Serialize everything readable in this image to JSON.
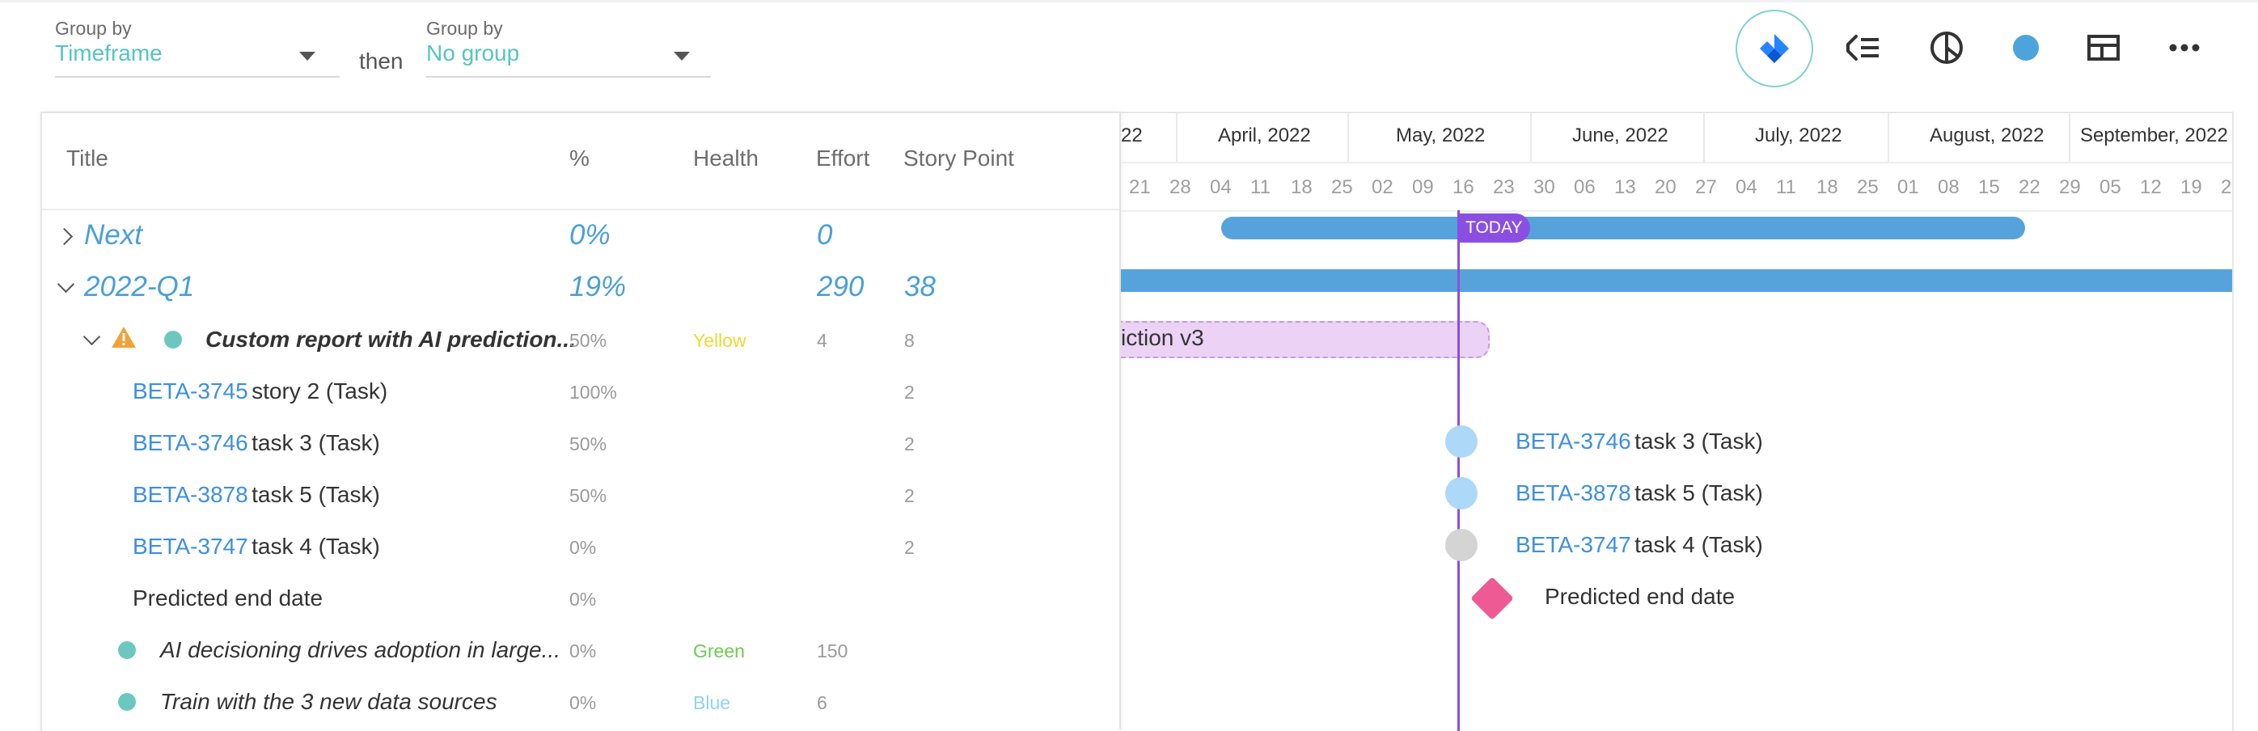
{
  "toolbar": {
    "group1_label": "Group by",
    "group1_value": "Timeframe",
    "then_label": "then",
    "group2_label": "Group by",
    "group2_value": "No group"
  },
  "table": {
    "headers": {
      "title": "Title",
      "percent": "%",
      "health": "Health",
      "effort": "Effort",
      "story_point": "Story Point"
    },
    "groups": [
      {
        "title": "Next",
        "percent": "0%",
        "effort": "0",
        "story_point": ""
      },
      {
        "title": "2022-Q1",
        "percent": "19%",
        "effort": "290",
        "story_point": "38"
      }
    ],
    "epic": {
      "title": "Custom report with AI prediction...",
      "percent": "50%",
      "health": "Yellow",
      "effort": "4",
      "story_point": "8"
    },
    "tasks": [
      {
        "key": "BETA-3745",
        "name": "story 2 (Task)",
        "percent": "100%",
        "story_point": "2"
      },
      {
        "key": "BETA-3746",
        "name": "task 3 (Task)",
        "percent": "50%",
        "story_point": "2"
      },
      {
        "key": "BETA-3878",
        "name": "task 5 (Task)",
        "percent": "50%",
        "story_point": "2"
      },
      {
        "key": "BETA-3747",
        "name": "task 4 (Task)",
        "percent": "0%",
        "story_point": "2"
      }
    ],
    "predicted": {
      "name": "Predicted end date",
      "percent": "0%"
    },
    "epics2": [
      {
        "title": "AI decisioning drives adoption in large...",
        "percent": "0%",
        "health": "Green",
        "effort": "150"
      },
      {
        "title": "Train with the 3 new data sources",
        "percent": "0%",
        "health": "Blue",
        "effort": "6"
      }
    ]
  },
  "gantt": {
    "months": [
      "22",
      "April, 2022",
      "May, 2022",
      "June, 2022",
      "July, 2022",
      "August, 2022",
      "September, 2022"
    ],
    "days": [
      "21",
      "28",
      "04",
      "11",
      "18",
      "25",
      "02",
      "09",
      "16",
      "23",
      "30",
      "06",
      "13",
      "20",
      "27",
      "04",
      "11",
      "18",
      "25",
      "01",
      "08",
      "15",
      "22",
      "29",
      "05",
      "12",
      "19",
      "2"
    ],
    "today_label": "TODAY",
    "epic_bar_label": "iction v3",
    "task_labels": [
      {
        "key": "BETA-3746",
        "name": "task 3 (Task)"
      },
      {
        "key": "BETA-3878",
        "name": "task 5 (Task)"
      },
      {
        "key": "BETA-3747",
        "name": "task 4 (Task)"
      }
    ],
    "predicted_label": "Predicted end date"
  },
  "colors": {
    "accent_blue": "#56a3db",
    "today_purple": "#8a4fe0",
    "health_yellow": "#f2d635",
    "health_green": "#6ccb4e",
    "health_blue": "#8fd3f4",
    "warning_orange": "#f0a23a",
    "diamond_pink": "#ee5b94"
  },
  "icons": [
    "jira-icon",
    "hierarchy-icon",
    "pie-chart-icon",
    "color-dot-icon",
    "layout-icon",
    "more-icon",
    "warning-icon"
  ]
}
